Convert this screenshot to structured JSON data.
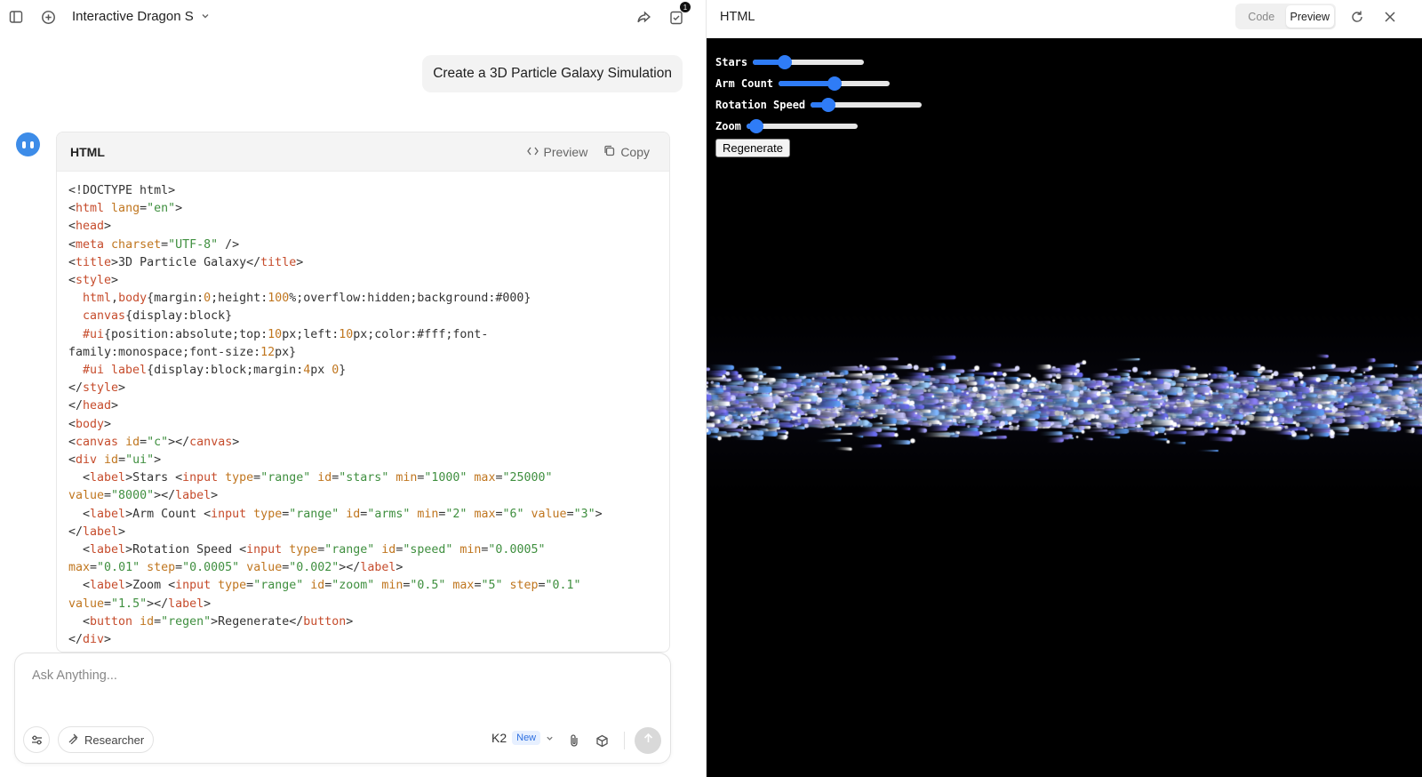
{
  "chat": {
    "title": "Interactive Dragon S",
    "notification_count": "1",
    "user_message": "Create a 3D Particle Galaxy Simulation",
    "code_block": {
      "language": "HTML",
      "preview_label": "Preview",
      "copy_label": "Copy",
      "lines": [
        [
          [
            "p",
            "<!DOCTYPE html>"
          ]
        ],
        [
          [
            "p",
            "<"
          ],
          [
            "t",
            "html"
          ],
          [
            "a",
            " lang"
          ],
          [
            "p",
            "="
          ],
          [
            "s",
            "\"en\""
          ],
          [
            "p",
            ">"
          ]
        ],
        [
          [
            "p",
            "<"
          ],
          [
            "t",
            "head"
          ],
          [
            "p",
            ">"
          ]
        ],
        [
          [
            "p",
            "<"
          ],
          [
            "t",
            "meta"
          ],
          [
            "a",
            " charset"
          ],
          [
            "p",
            "="
          ],
          [
            "s",
            "\"UTF-8\""
          ],
          [
            "p",
            " />"
          ]
        ],
        [
          [
            "p",
            "<"
          ],
          [
            "t",
            "title"
          ],
          [
            "p",
            ">3D Particle Galaxy</"
          ],
          [
            "t",
            "title"
          ],
          [
            "p",
            ">"
          ]
        ],
        [
          [
            "p",
            "<"
          ],
          [
            "t",
            "style"
          ],
          [
            "p",
            ">"
          ]
        ],
        [
          [
            "p",
            "  "
          ],
          [
            "t",
            "html"
          ],
          [
            "p",
            ","
          ],
          [
            "t",
            "body"
          ],
          [
            "p",
            "{margin:"
          ],
          [
            "n",
            "0"
          ],
          [
            "p",
            ";height:"
          ],
          [
            "n",
            "100"
          ],
          [
            "p",
            "%;overflow:hidden;background:#000}"
          ]
        ],
        [
          [
            "p",
            "  "
          ],
          [
            "t",
            "canvas"
          ],
          [
            "p",
            "{display:block}"
          ]
        ],
        [
          [
            "p",
            "  "
          ],
          [
            "t",
            "#ui"
          ],
          [
            "p",
            "{position:absolute;top:"
          ],
          [
            "n",
            "10"
          ],
          [
            "p",
            "px;left:"
          ],
          [
            "n",
            "10"
          ],
          [
            "p",
            "px;color:#fff;font-"
          ]
        ],
        [
          [
            "p",
            "family:monospace;font-size:"
          ],
          [
            "n",
            "12"
          ],
          [
            "p",
            "px}"
          ]
        ],
        [
          [
            "p",
            "  "
          ],
          [
            "t",
            "#ui label"
          ],
          [
            "p",
            "{display:block;margin:"
          ],
          [
            "n",
            "4"
          ],
          [
            "p",
            "px "
          ],
          [
            "n",
            "0"
          ],
          [
            "p",
            "}"
          ]
        ],
        [
          [
            "p",
            "</"
          ],
          [
            "t",
            "style"
          ],
          [
            "p",
            ">"
          ]
        ],
        [
          [
            "p",
            "</"
          ],
          [
            "t",
            "head"
          ],
          [
            "p",
            ">"
          ]
        ],
        [
          [
            "p",
            "<"
          ],
          [
            "t",
            "body"
          ],
          [
            "p",
            ">"
          ]
        ],
        [
          [
            "p",
            "<"
          ],
          [
            "t",
            "canvas"
          ],
          [
            "a",
            " id"
          ],
          [
            "p",
            "="
          ],
          [
            "s",
            "\"c\""
          ],
          [
            "p",
            "></"
          ],
          [
            "t",
            "canvas"
          ],
          [
            "p",
            ">"
          ]
        ],
        [
          [
            "p",
            "<"
          ],
          [
            "t",
            "div"
          ],
          [
            "a",
            " id"
          ],
          [
            "p",
            "="
          ],
          [
            "s",
            "\"ui\""
          ],
          [
            "p",
            ">"
          ]
        ],
        [
          [
            "p",
            "  <"
          ],
          [
            "t",
            "label"
          ],
          [
            "p",
            ">Stars <"
          ],
          [
            "t",
            "input"
          ],
          [
            "a",
            " type"
          ],
          [
            "p",
            "="
          ],
          [
            "s",
            "\"range\""
          ],
          [
            "a",
            " id"
          ],
          [
            "p",
            "="
          ],
          [
            "s",
            "\"stars\""
          ],
          [
            "a",
            " min"
          ],
          [
            "p",
            "="
          ],
          [
            "s",
            "\"1000\""
          ],
          [
            "a",
            " max"
          ],
          [
            "p",
            "="
          ],
          [
            "s",
            "\"25000\""
          ]
        ],
        [
          [
            "a",
            "value"
          ],
          [
            "p",
            "="
          ],
          [
            "s",
            "\"8000\""
          ],
          [
            "p",
            "></"
          ],
          [
            "t",
            "label"
          ],
          [
            "p",
            ">"
          ]
        ],
        [
          [
            "p",
            "  <"
          ],
          [
            "t",
            "label"
          ],
          [
            "p",
            ">Arm Count <"
          ],
          [
            "t",
            "input"
          ],
          [
            "a",
            " type"
          ],
          [
            "p",
            "="
          ],
          [
            "s",
            "\"range\""
          ],
          [
            "a",
            " id"
          ],
          [
            "p",
            "="
          ],
          [
            "s",
            "\"arms\""
          ],
          [
            "a",
            " min"
          ],
          [
            "p",
            "="
          ],
          [
            "s",
            "\"2\""
          ],
          [
            "a",
            " max"
          ],
          [
            "p",
            "="
          ],
          [
            "s",
            "\"6\""
          ],
          [
            "a",
            " value"
          ],
          [
            "p",
            "="
          ],
          [
            "s",
            "\"3\""
          ],
          [
            "p",
            ">"
          ]
        ],
        [
          [
            "p",
            "</"
          ],
          [
            "t",
            "label"
          ],
          [
            "p",
            ">"
          ]
        ],
        [
          [
            "p",
            "  <"
          ],
          [
            "t",
            "label"
          ],
          [
            "p",
            ">Rotation Speed <"
          ],
          [
            "t",
            "input"
          ],
          [
            "a",
            " type"
          ],
          [
            "p",
            "="
          ],
          [
            "s",
            "\"range\""
          ],
          [
            "a",
            " id"
          ],
          [
            "p",
            "="
          ],
          [
            "s",
            "\"speed\""
          ],
          [
            "a",
            " min"
          ],
          [
            "p",
            "="
          ],
          [
            "s",
            "\"0.0005\""
          ]
        ],
        [
          [
            "a",
            "max"
          ],
          [
            "p",
            "="
          ],
          [
            "s",
            "\"0.01\""
          ],
          [
            "a",
            " step"
          ],
          [
            "p",
            "="
          ],
          [
            "s",
            "\"0.0005\""
          ],
          [
            "a",
            " value"
          ],
          [
            "p",
            "="
          ],
          [
            "s",
            "\"0.002\""
          ],
          [
            "p",
            "></"
          ],
          [
            "t",
            "label"
          ],
          [
            "p",
            ">"
          ]
        ],
        [
          [
            "p",
            "  <"
          ],
          [
            "t",
            "label"
          ],
          [
            "p",
            ">Zoom <"
          ],
          [
            "t",
            "input"
          ],
          [
            "a",
            " type"
          ],
          [
            "p",
            "="
          ],
          [
            "s",
            "\"range\""
          ],
          [
            "a",
            " id"
          ],
          [
            "p",
            "="
          ],
          [
            "s",
            "\"zoom\""
          ],
          [
            "a",
            " min"
          ],
          [
            "p",
            "="
          ],
          [
            "s",
            "\"0.5\""
          ],
          [
            "a",
            " max"
          ],
          [
            "p",
            "="
          ],
          [
            "s",
            "\"5\""
          ],
          [
            "a",
            " step"
          ],
          [
            "p",
            "="
          ],
          [
            "s",
            "\"0.1\""
          ]
        ],
        [
          [
            "a",
            "value"
          ],
          [
            "p",
            "="
          ],
          [
            "s",
            "\"1.5\""
          ],
          [
            "p",
            "></"
          ],
          [
            "t",
            "label"
          ],
          [
            "p",
            ">"
          ]
        ],
        [
          [
            "p",
            "  <"
          ],
          [
            "t",
            "button"
          ],
          [
            "a",
            " id"
          ],
          [
            "p",
            "="
          ],
          [
            "s",
            "\"regen\""
          ],
          [
            "p",
            ">Regenerate</"
          ],
          [
            "t",
            "button"
          ],
          [
            "p",
            ">"
          ]
        ],
        [
          [
            "p",
            "</"
          ],
          [
            "t",
            "div"
          ],
          [
            "p",
            ">"
          ]
        ]
      ]
    },
    "input": {
      "placeholder": "Ask Anything...",
      "researcher_label": "Researcher",
      "model_label": "K2",
      "model_tag": "New"
    }
  },
  "preview": {
    "title": "HTML",
    "tabs": [
      "Code",
      "Preview"
    ],
    "active_tab": "Preview",
    "controls": [
      {
        "label": "Stars",
        "value": 8000,
        "min": 1000,
        "max": 25000,
        "fraction": 0.29
      },
      {
        "label": "Arm Count",
        "value": 3,
        "min": 2,
        "max": 6,
        "fraction": 0.5
      },
      {
        "label": "Rotation Speed",
        "value": 0.002,
        "min": 0.0005,
        "max": 0.01,
        "fraction": 0.16
      },
      {
        "label": "Zoom",
        "value": 1.5,
        "min": 0.5,
        "max": 5,
        "fraction": 0.09
      }
    ],
    "regenerate_label": "Regenerate",
    "colors": {
      "slider": "#2f7cf6",
      "stage_bg": "#000000"
    }
  }
}
